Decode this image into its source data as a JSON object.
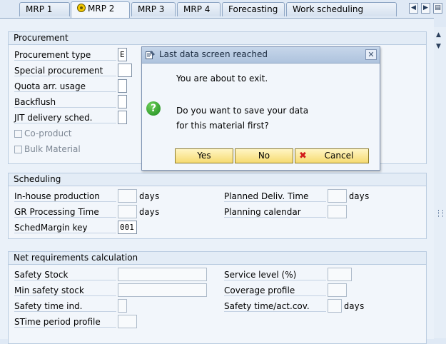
{
  "tabs": [
    {
      "label": "MRP 1",
      "active": false
    },
    {
      "label": "MRP 2",
      "active": true
    },
    {
      "label": "MRP 3",
      "active": false
    },
    {
      "label": "MRP 4",
      "active": false
    },
    {
      "label": "Forecasting",
      "active": false
    },
    {
      "label": "Work scheduling",
      "active": false
    }
  ],
  "procurement": {
    "title": "Procurement",
    "procurement_type": {
      "label": "Procurement type",
      "value": "E"
    },
    "special_procurement": {
      "label": "Special procurement",
      "value": ""
    },
    "quota_usage": {
      "label": "Quota arr. usage",
      "value": ""
    },
    "backflush": {
      "label": "Backflush",
      "value": ""
    },
    "jit_delivery": {
      "label": "JIT delivery sched.",
      "value": ""
    },
    "co_product": {
      "label": "Co-product",
      "checked": false
    },
    "bulk_material": {
      "label": "Bulk Material",
      "checked": false
    }
  },
  "scheduling": {
    "title": "Scheduling",
    "inhouse_production": {
      "label": "In-house production",
      "value": "",
      "unit": "days"
    },
    "gr_processing": {
      "label": "GR Processing Time",
      "value": "",
      "unit": "days"
    },
    "schedmargin": {
      "label": "SchedMargin key",
      "value": "001"
    },
    "planned_deliv": {
      "label": "Planned Deliv. Time",
      "value": "",
      "unit": "days"
    },
    "planning_calendar": {
      "label": "Planning calendar",
      "value": ""
    }
  },
  "net_requirements": {
    "title": "Net requirements calculation",
    "safety_stock": {
      "label": "Safety Stock",
      "value": ""
    },
    "min_safety_stock": {
      "label": "Min safety stock",
      "value": ""
    },
    "safety_time_ind": {
      "label": "Safety time ind.",
      "value": ""
    },
    "stime_period_profile": {
      "label": "STime period profile",
      "value": ""
    },
    "service_level": {
      "label": "Service level (%)",
      "value": ""
    },
    "coverage_profile": {
      "label": "Coverage profile",
      "value": ""
    },
    "safety_time_act": {
      "label": "Safety time/act.cov.",
      "value": "",
      "unit": "days"
    }
  },
  "dialog": {
    "title": "Last data screen reached",
    "line1": "You are about to exit.",
    "line2": "Do you want to save your data",
    "line3": "for this material first?",
    "yes": "Yes",
    "no": "No",
    "cancel": "Cancel"
  },
  "icons": {
    "tab_active": "status-circle-icon",
    "dialog_title": "dialog-icon",
    "question": "question-mark-icon",
    "cancel": "red-x-icon",
    "close": "close-icon",
    "nav_left": "arrow-left-icon",
    "nav_right": "arrow-right-icon",
    "tab_list": "tab-list-icon"
  },
  "colors": {
    "button_yellow": "#f6db71",
    "question_green": "#1c8a1e",
    "cancel_red": "#d11b1b",
    "panel_bg": "#eaf1f9"
  }
}
